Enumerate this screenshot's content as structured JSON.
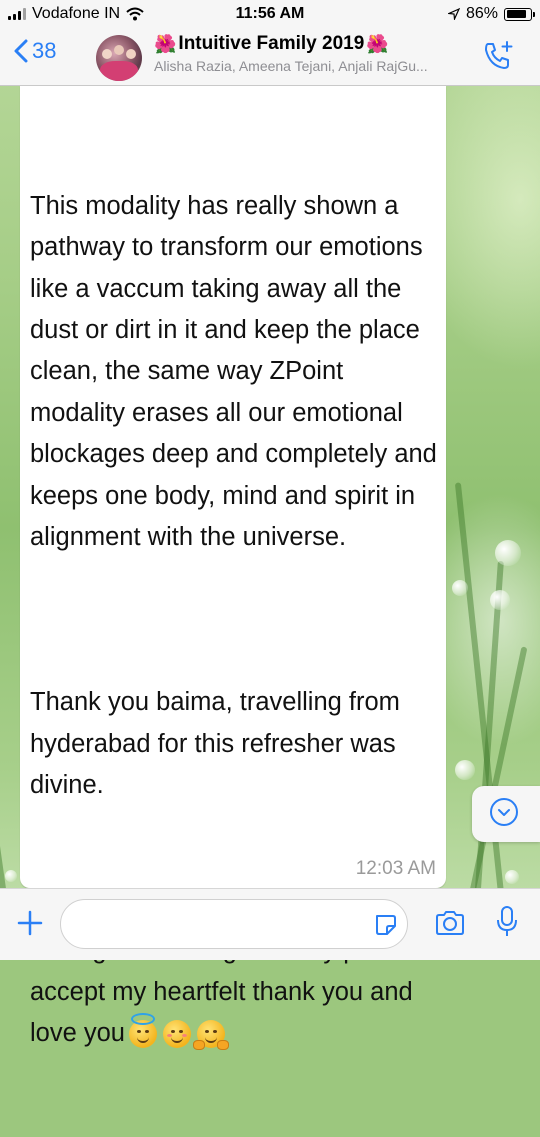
{
  "status_bar": {
    "carrier": "Vodafone IN",
    "time": "11:56 AM",
    "battery": "86%",
    "battery_level": 0.86
  },
  "header": {
    "back_count": "38",
    "title": "Intuitive Family 2019",
    "title_emoji": "🌺",
    "subtitle": "Alisha Razia, Ameena Tejani, Anjali RajGu...",
    "call_icon": "add-call-icon"
  },
  "message": {
    "paragraphs": [
      "This modality has really shown a pathway to transform our emotions like a vaccum taking away all the dust or dirt in it and keep the place clean, the same way ZPoint modality erases all our emotional blockages deep and completely and keeps one body, mind and spirit in alignment with the universe.",
      "Thank you baima, travelling from hyderabad for this refresher was divine.",
      "I can go on writing so lastly please accept my heartfelt thank you and love you"
    ],
    "emojis": [
      "smiling-face-with-halo",
      "smiling-face-with-smiling-eyes",
      "hugging-face"
    ],
    "time": "12:03 AM"
  },
  "input": {
    "placeholder": ""
  },
  "colors": {
    "accent": "#2a7ff5",
    "bar_background": "#f6f6f6",
    "timestamp": "#9a9a9a"
  }
}
